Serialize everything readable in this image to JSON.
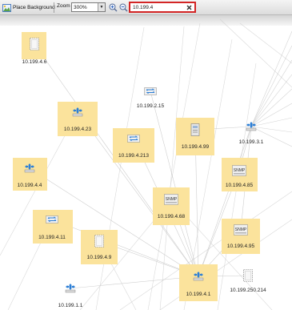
{
  "toolbar": {
    "place_background_label": "Place Background",
    "zoom_label": "Zoom",
    "zoom_value": "300%",
    "search_value": "10.199.4"
  },
  "colors": {
    "highlight_box": "#fbe39c",
    "search_border": "#d32525",
    "link_line": "#c9c9c9"
  },
  "nodes": [
    {
      "id": "n1",
      "label": "10.199.4.6",
      "icon": "server-icon",
      "highlighted": true
    },
    {
      "id": "n2",
      "label": "10.199.2.15",
      "icon": "router-icon",
      "highlighted": false
    },
    {
      "id": "n3",
      "label": "10.199.4.23",
      "icon": "switch-icon",
      "highlighted": true
    },
    {
      "id": "n4",
      "label": "10.199.4.213",
      "icon": "router-icon",
      "highlighted": true
    },
    {
      "id": "n5",
      "label": "10.199.4.99",
      "icon": "workstation-icon",
      "highlighted": true
    },
    {
      "id": "n6",
      "label": "10.199.3.1",
      "icon": "switch-icon",
      "highlighted": false
    },
    {
      "id": "n7",
      "label": "10.199.4.4",
      "icon": "switch-icon",
      "highlighted": true
    },
    {
      "id": "n8",
      "label": "10.199.4.85",
      "icon": "snmp-icon",
      "highlighted": true
    },
    {
      "id": "n9",
      "label": "10.199.4.68",
      "icon": "snmp-icon",
      "highlighted": true
    },
    {
      "id": "n10",
      "label": "10.199.4.11",
      "icon": "router-icon",
      "highlighted": true
    },
    {
      "id": "n11",
      "label": "10.199.4.95",
      "icon": "snmp-icon",
      "highlighted": true
    },
    {
      "id": "n12",
      "label": "10.199.4.9",
      "icon": "server-icon",
      "highlighted": true
    },
    {
      "id": "n13",
      "label": "10.199.4.1",
      "icon": "switch-icon",
      "highlighted": true
    },
    {
      "id": "n14",
      "label": "10.199.250.214",
      "icon": "server-icon",
      "highlighted": false
    },
    {
      "id": "n15",
      "label": "10.199.1.1",
      "icon": "switch-icon",
      "highlighted": false
    }
  ],
  "snmp_text": "SNMP"
}
